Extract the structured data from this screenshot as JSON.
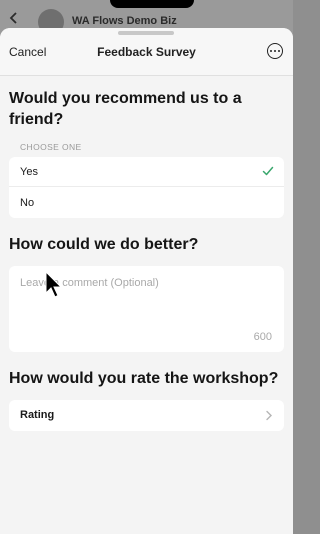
{
  "background_chat": {
    "title": "WA Flows Demo Biz"
  },
  "sheet": {
    "cancel_label": "Cancel",
    "title": "Feedback Survey",
    "more_icon": "more-options-icon"
  },
  "question1": {
    "heading": "Would you recommend us to a friend?",
    "choose_label": "CHOOSE ONE",
    "options": [
      {
        "label": "Yes",
        "selected": true
      },
      {
        "label": "No",
        "selected": false
      }
    ]
  },
  "question2": {
    "heading": "How could we do better?",
    "placeholder": "Leave a comment (Optional)",
    "char_limit": "600"
  },
  "question3": {
    "heading": "How would you rate the workshop?",
    "rating_label": "Rating"
  },
  "colors": {
    "check": "#3aa76d",
    "accent_text": "#151515"
  }
}
